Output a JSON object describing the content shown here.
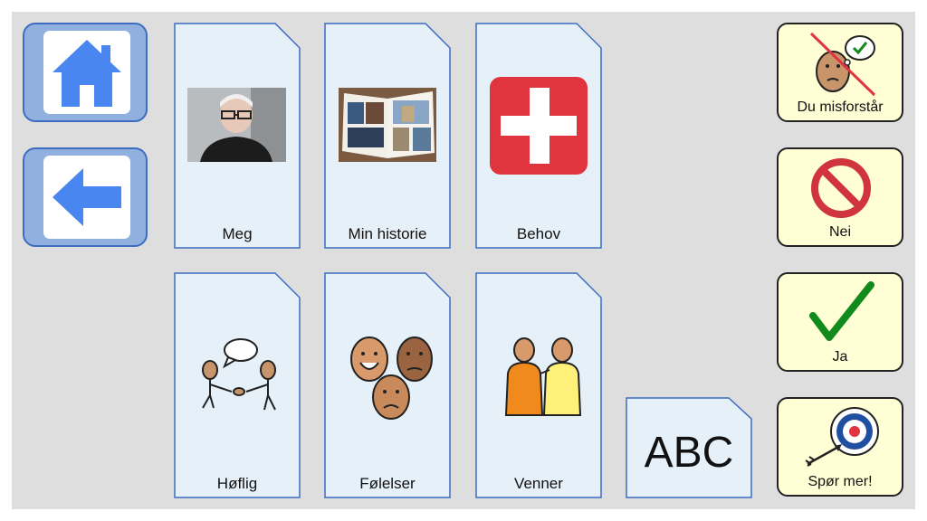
{
  "nav": {
    "home_icon": "home-icon",
    "back_icon": "back-arrow-icon"
  },
  "folders": [
    {
      "label": "Meg",
      "icon": "person-photo"
    },
    {
      "label": "Min historie",
      "icon": "book-photo"
    },
    {
      "label": "Behov",
      "icon": "red-cross-icon"
    },
    {
      "label": "Høflig",
      "icon": "handshake-icon"
    },
    {
      "label": "Følelser",
      "icon": "faces-icon"
    },
    {
      "label": "Venner",
      "icon": "friends-icon"
    }
  ],
  "keyboard": {
    "label": "ABC"
  },
  "quick": [
    {
      "label": "Du misforstår",
      "icon": "misunderstand-icon"
    },
    {
      "label": "Nei",
      "icon": "no-sign-icon"
    },
    {
      "label": "Ja",
      "icon": "checkmark-icon"
    },
    {
      "label": "Spør mer!",
      "icon": "target-icon"
    }
  ],
  "colors": {
    "background": "#dedede",
    "folder_fill": "#e6f0f8",
    "folder_border": "#3d6cc0",
    "nav_fill": "#90b0e0",
    "icon_blue": "#4a86f0",
    "quick_fill": "#fffed4",
    "red": "#e0353f",
    "green": "#118a1d"
  }
}
